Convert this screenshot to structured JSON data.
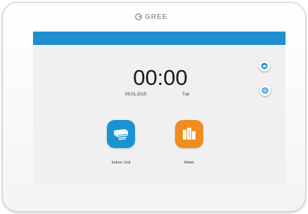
{
  "device": {
    "brand": "GREE"
  },
  "header": {
    "bar_color": "#1e8fd0"
  },
  "clock": {
    "time": "00:00",
    "date": "09.01.2015",
    "weekday": "Tue"
  },
  "side_buttons": [
    {
      "icon": "cloud-icon"
    },
    {
      "icon": "settings-icon"
    }
  ],
  "tiles": [
    {
      "label": "Indoor Unit",
      "icon": "indoor-unit-icon",
      "color": "#1a93d3"
    },
    {
      "label": "Water",
      "icon": "water-heater-icon",
      "color": "#f28c1f"
    }
  ]
}
